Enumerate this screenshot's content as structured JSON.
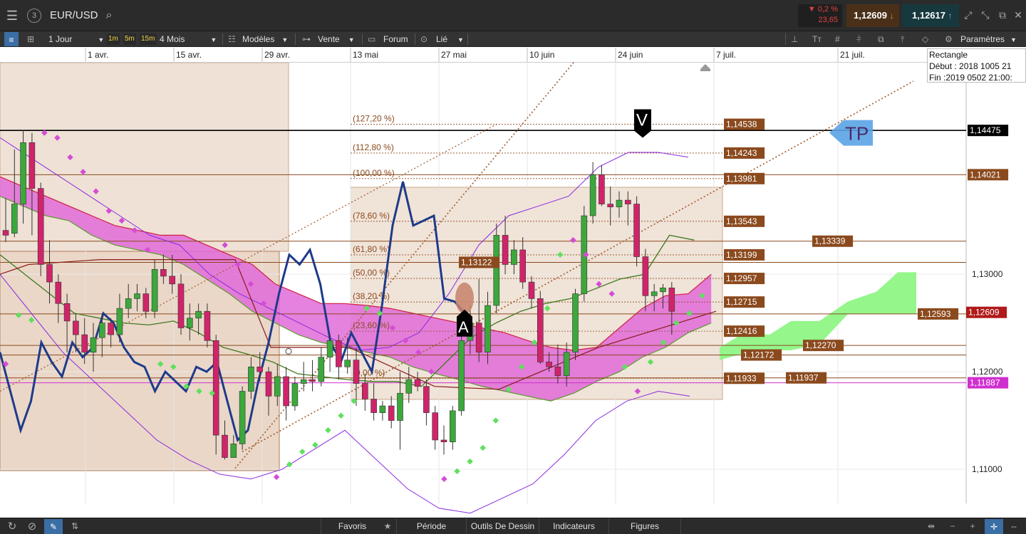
{
  "topbar": {
    "menu_icon": "hamburger-icon",
    "badge_count": "3",
    "symbol": "EUR/USD",
    "search_icon": "search-icon",
    "change_pct": "▼ 0,2 %",
    "change_pts": "23,65",
    "bid": "1,12609",
    "ask": "1,12617"
  },
  "toolbar": {
    "timeframe": "1 Jour",
    "btn_1m": "1m",
    "btn_5m": "5m",
    "btn_15m": "15m",
    "period": "4 Mois",
    "models": "Modèles",
    "sell": "Vente",
    "forum": "Forum",
    "linked": "Lié",
    "settings": "Paramètres"
  },
  "bottombar": {
    "favorites": "Favoris",
    "period": "Période",
    "drawing_tools": "Outils De Dessin",
    "indicators": "Indicateurs",
    "figures": "Figures"
  },
  "info_box": {
    "line1": "Rectangle",
    "line2": "Début : 2018 1005 21",
    "line3": "Fin :2019 0502 21:00:"
  },
  "chart_data": {
    "type": "candlestick",
    "symbol": "EUR/USD",
    "timeframe": "1 Jour",
    "x_ticks": [
      "1 avr.",
      "15 avr.",
      "29 avr.",
      "13 mai",
      "27 mai",
      "10 juin",
      "24 juin",
      "7 juil.",
      "21 juil."
    ],
    "y_ticks": [
      "1,11000",
      "1,12000",
      "1,13000"
    ],
    "ylim": [
      1.1065,
      1.1517
    ],
    "current_price": "1,12609",
    "fibonacci": [
      {
        "label": "(127,20 %)",
        "value": "1,14538"
      },
      {
        "label": "(112,80 %)",
        "value": "1,14243"
      },
      {
        "label": "(100,00 %)",
        "value": "1,13981"
      },
      {
        "label": "(78,60 %)",
        "value": "1,13543"
      },
      {
        "label": "(61,80 %)",
        "value": "1,13199"
      },
      {
        "label": "(50,00 %)",
        "value": "1,12957"
      },
      {
        "label": "(38,20 %)",
        "value": "1,12715"
      },
      {
        "label": "(23,60 %)",
        "value": "1,12416"
      },
      {
        "label": "(0,00 %)",
        "value": "1,11933"
      }
    ],
    "horizontal_levels": [
      {
        "value": "1,14475",
        "color": "#000000"
      },
      {
        "value": "1,14021",
        "color": "#8b4a1e"
      },
      {
        "value": "1,13339",
        "color": "#8b4a1e"
      },
      {
        "value": "1,13122",
        "color": "#8b4a1e"
      },
      {
        "value": "1,12593",
        "color": "#8b4a1e"
      },
      {
        "value": "1,12270",
        "color": "#8b4a1e"
      },
      {
        "value": "1,12172",
        "color": "#8b4a1e"
      },
      {
        "value": "1,11937",
        "color": "#8b4a1e"
      },
      {
        "value": "1,11887",
        "color": "#d02fd0"
      }
    ],
    "annotations": {
      "V": "V",
      "A": "A",
      "TP": "TP"
    },
    "candles_ohlc": [
      [
        1.1345,
        1.1378,
        1.1333,
        1.134
      ],
      [
        1.1342,
        1.1428,
        1.1338,
        1.1372
      ],
      [
        1.1372,
        1.1448,
        1.1352,
        1.1435
      ],
      [
        1.1435,
        1.1445,
        1.134,
        1.1388
      ],
      [
        1.1388,
        1.1394,
        1.1298,
        1.131
      ],
      [
        1.131,
        1.1335,
        1.127,
        1.1292
      ],
      [
        1.1292,
        1.13,
        1.125,
        1.127
      ],
      [
        1.127,
        1.128,
        1.122,
        1.1252
      ],
      [
        1.1252,
        1.126,
        1.122,
        1.1238
      ],
      [
        1.1238,
        1.1255,
        1.1208,
        1.122
      ],
      [
        1.122,
        1.125,
        1.12,
        1.1235
      ],
      [
        1.1235,
        1.126,
        1.1215,
        1.125
      ],
      [
        1.125,
        1.1255,
        1.1225,
        1.1238
      ],
      [
        1.1238,
        1.128,
        1.123,
        1.1265
      ],
      [
        1.1265,
        1.129,
        1.1255,
        1.1275
      ],
      [
        1.1275,
        1.129,
        1.1262,
        1.128
      ],
      [
        1.128,
        1.1286,
        1.1255,
        1.1262
      ],
      [
        1.1262,
        1.1315,
        1.1255,
        1.1305
      ],
      [
        1.1305,
        1.132,
        1.129,
        1.1298
      ],
      [
        1.1298,
        1.132,
        1.128,
        1.129
      ],
      [
        1.129,
        1.13,
        1.1238,
        1.1245
      ],
      [
        1.1245,
        1.127,
        1.1232,
        1.1255
      ],
      [
        1.1255,
        1.127,
        1.1238,
        1.1262
      ],
      [
        1.1262,
        1.127,
        1.1225,
        1.1232
      ],
      [
        1.1232,
        1.1238,
        1.1115,
        1.1135
      ],
      [
        1.1135,
        1.115,
        1.111,
        1.1112
      ],
      [
        1.1112,
        1.1135,
        1.1112,
        1.1126
      ],
      [
        1.1126,
        1.1185,
        1.112,
        1.118
      ],
      [
        1.118,
        1.1215,
        1.1172,
        1.1205
      ],
      [
        1.1205,
        1.122,
        1.119,
        1.12
      ],
      [
        1.12,
        1.1205,
        1.1155,
        1.1175
      ],
      [
        1.1175,
        1.1208,
        1.1165,
        1.1195
      ],
      [
        1.1195,
        1.1205,
        1.115,
        1.1165
      ],
      [
        1.1165,
        1.1195,
        1.116,
        1.1188
      ],
      [
        1.1188,
        1.121,
        1.118,
        1.1192
      ],
      [
        1.1192,
        1.1212,
        1.118,
        1.119
      ],
      [
        1.119,
        1.1225,
        1.1185,
        1.1215
      ],
      [
        1.1215,
        1.1238,
        1.12,
        1.1232
      ],
      [
        1.1232,
        1.1238,
        1.1192,
        1.1205
      ],
      [
        1.1205,
        1.1235,
        1.1198,
        1.1212
      ],
      [
        1.1212,
        1.1225,
        1.1165,
        1.1188
      ],
      [
        1.1188,
        1.1198,
        1.116,
        1.1172
      ],
      [
        1.1172,
        1.1188,
        1.115,
        1.1158
      ],
      [
        1.1158,
        1.117,
        1.115,
        1.1165
      ],
      [
        1.1165,
        1.1175,
        1.1142,
        1.115
      ],
      [
        1.115,
        1.12,
        1.112,
        1.1178
      ],
      [
        1.1178,
        1.1205,
        1.1168,
        1.1192
      ],
      [
        1.1192,
        1.12,
        1.118,
        1.1185
      ],
      [
        1.1185,
        1.1192,
        1.1145,
        1.1158
      ],
      [
        1.1158,
        1.1165,
        1.112,
        1.113
      ],
      [
        1.113,
        1.1145,
        1.1115,
        1.1128
      ],
      [
        1.1128,
        1.1165,
        1.112,
        1.116
      ],
      [
        1.116,
        1.1245,
        1.1155,
        1.1232
      ],
      [
        1.1232,
        1.1268,
        1.1218,
        1.125
      ],
      [
        1.125,
        1.1295,
        1.121,
        1.122
      ],
      [
        1.122,
        1.1282,
        1.1208,
        1.1268
      ],
      [
        1.1268,
        1.1352,
        1.126,
        1.134
      ],
      [
        1.134,
        1.136,
        1.13,
        1.131
      ],
      [
        1.131,
        1.1335,
        1.13,
        1.1325
      ],
      [
        1.1325,
        1.1338,
        1.1285,
        1.1292
      ],
      [
        1.1292,
        1.1298,
        1.1265,
        1.1275
      ],
      [
        1.1275,
        1.1283,
        1.1208,
        1.121
      ],
      [
        1.121,
        1.122,
        1.12,
        1.1205
      ],
      [
        1.1205,
        1.1228,
        1.1188,
        1.1196
      ],
      [
        1.1196,
        1.123,
        1.1185,
        1.122
      ],
      [
        1.122,
        1.1285,
        1.1212,
        1.128
      ],
      [
        1.128,
        1.137,
        1.1272,
        1.136
      ],
      [
        1.136,
        1.1415,
        1.1352,
        1.1402
      ],
      [
        1.1402,
        1.1412,
        1.137,
        1.1372
      ],
      [
        1.1372,
        1.139,
        1.135,
        1.1369
      ],
      [
        1.1369,
        1.1385,
        1.1358,
        1.1376
      ],
      [
        1.1376,
        1.1385,
        1.135,
        1.1372
      ],
      [
        1.1372,
        1.138,
        1.1308,
        1.1318
      ],
      [
        1.1318,
        1.1326,
        1.1262,
        1.1278
      ],
      [
        1.1278,
        1.129,
        1.1262,
        1.1282
      ],
      [
        1.1282,
        1.129,
        1.1265,
        1.1286
      ],
      [
        1.1286,
        1.1292,
        1.1238,
        1.1262
      ]
    ],
    "blue_line": [
      1.122,
      1.118,
      1.114,
      1.117,
      1.123,
      1.121,
      1.1195,
      1.123,
      1.1215,
      1.1225,
      1.126,
      1.125,
      1.1225,
      1.121,
      1.1205,
      1.118,
      1.12,
      1.119,
      1.118,
      1.1205,
      1.12,
      1.121,
      1.117,
      1.113,
      1.114,
      1.119,
      1.123,
      1.128,
      1.132,
      1.131,
      1.1325,
      1.129,
      1.123,
      1.121,
      1.124,
      1.122,
      1.12,
      1.127,
      1.135,
      1.1395,
      1.135,
      1.1355,
      1.136,
      1.1275,
      1.1272,
      1.126
    ],
    "tenkan_line": [
      1.132,
      1.13,
      1.128,
      1.126,
      1.1255,
      1.125,
      1.1248,
      1.1252,
      1.124,
      1.1225,
      1.1218,
      1.121,
      1.1198,
      1.1195,
      1.1192,
      1.119,
      1.119,
      1.1185,
      1.121,
      1.1235,
      1.125,
      1.1262,
      1.127,
      1.1275,
      1.1285,
      1.1295,
      1.13,
      1.134,
      1.1335
    ],
    "cloud_upper": [
      1.14,
      1.139,
      1.138,
      1.137,
      1.136,
      1.135,
      1.1345,
      1.134,
      1.134,
      1.133,
      1.132,
      1.131,
      1.129,
      1.128,
      1.127,
      1.127,
      1.1268,
      1.1265,
      1.126,
      1.1255,
      1.125,
      1.1245,
      1.124,
      1.1232,
      1.1225,
      1.1222,
      1.1225,
      1.1245,
      1.1265,
      1.1278,
      1.128,
      1.13
    ],
    "cloud_lower": [
      1.138,
      1.137,
      1.136,
      1.1355,
      1.134,
      1.133,
      1.1325,
      1.132,
      1.131,
      1.1295,
      1.128,
      1.1262,
      1.125,
      1.1238,
      1.123,
      1.1225,
      1.122,
      1.1215,
      1.1205,
      1.1198,
      1.1192,
      1.1185,
      1.118,
      1.1175,
      1.117,
      1.1178,
      1.119,
      1.12,
      1.1215,
      1.1225,
      1.124,
      1.125
    ],
    "bollinger_upper": [
      1.144,
      1.142,
      1.14,
      1.138,
      1.136,
      1.134,
      1.133,
      1.13,
      1.128,
      1.1265,
      1.125,
      1.1235,
      1.1222,
      1.1225,
      1.124,
      1.128,
      1.133,
      1.136,
      1.137,
      1.138,
      1.141,
      1.1425,
      1.1425,
      1.142
    ],
    "bollinger_lower": [
      1.13,
      1.126,
      1.122,
      1.119,
      1.116,
      1.113,
      1.111,
      1.1095,
      1.109,
      1.11,
      1.112,
      1.114,
      1.111,
      1.108,
      1.106,
      1.1055,
      1.107,
      1.1085,
      1.1115,
      1.115,
      1.117,
      1.118,
      1.1175
    ],
    "parabolic_sar": [
      [
        1.1208,
        "magenta"
      ],
      [
        1.1258,
        "green"
      ],
      [
        1.1253,
        "green"
      ],
      [
        1.1445,
        "magenta"
      ],
      [
        1.144,
        "magenta"
      ],
      [
        1.142,
        "magenta"
      ],
      [
        1.1405,
        "magenta"
      ],
      [
        1.1385,
        "magenta"
      ],
      [
        1.1365,
        "magenta"
      ],
      [
        1.1355,
        "magenta"
      ],
      [
        1.1345,
        "magenta"
      ],
      [
        1.1325,
        "magenta"
      ],
      [
        1.1208,
        "green"
      ],
      [
        1.1205,
        "green"
      ],
      [
        1.1185,
        "green"
      ],
      [
        1.118,
        "green"
      ],
      [
        1.1178,
        "green"
      ],
      [
        1.133,
        "magenta"
      ],
      [
        1.131,
        "magenta"
      ],
      [
        1.129,
        "magenta"
      ],
      [
        1.127,
        "magenta"
      ],
      [
        1.1092,
        "magenta"
      ],
      [
        1.1105,
        "green"
      ],
      [
        1.1118,
        "green"
      ],
      [
        1.1125,
        "green"
      ],
      [
        1.114,
        "green"
      ],
      [
        1.1155,
        "green"
      ],
      [
        1.117,
        "green"
      ],
      [
        1.1265,
        "green"
      ],
      [
        1.126,
        "green"
      ],
      [
        1.1245,
        "magenta"
      ],
      [
        1.1232,
        "magenta"
      ],
      [
        1.122,
        "magenta"
      ],
      [
        1.12,
        "magenta"
      ],
      [
        1.109,
        "magenta"
      ],
      [
        1.1098,
        "green"
      ],
      [
        1.1108,
        "green"
      ],
      [
        1.1122,
        "green"
      ],
      [
        1.115,
        "green"
      ],
      [
        1.1182,
        "green"
      ],
      [
        1.1205,
        "green"
      ],
      [
        1.123,
        "green"
      ],
      [
        1.1265,
        "green"
      ],
      [
        1.132,
        "green"
      ],
      [
        1.1335,
        "magenta"
      ],
      [
        1.132,
        "magenta"
      ],
      [
        1.129,
        "magenta"
      ],
      [
        1.128,
        "magenta"
      ],
      [
        1.1205,
        "green"
      ],
      [
        1.118,
        "magenta"
      ],
      [
        1.121,
        "green"
      ],
      [
        1.123,
        "green"
      ],
      [
        1.125,
        "green"
      ],
      [
        1.126,
        "green"
      ],
      [
        1.1278,
        "green"
      ]
    ]
  }
}
